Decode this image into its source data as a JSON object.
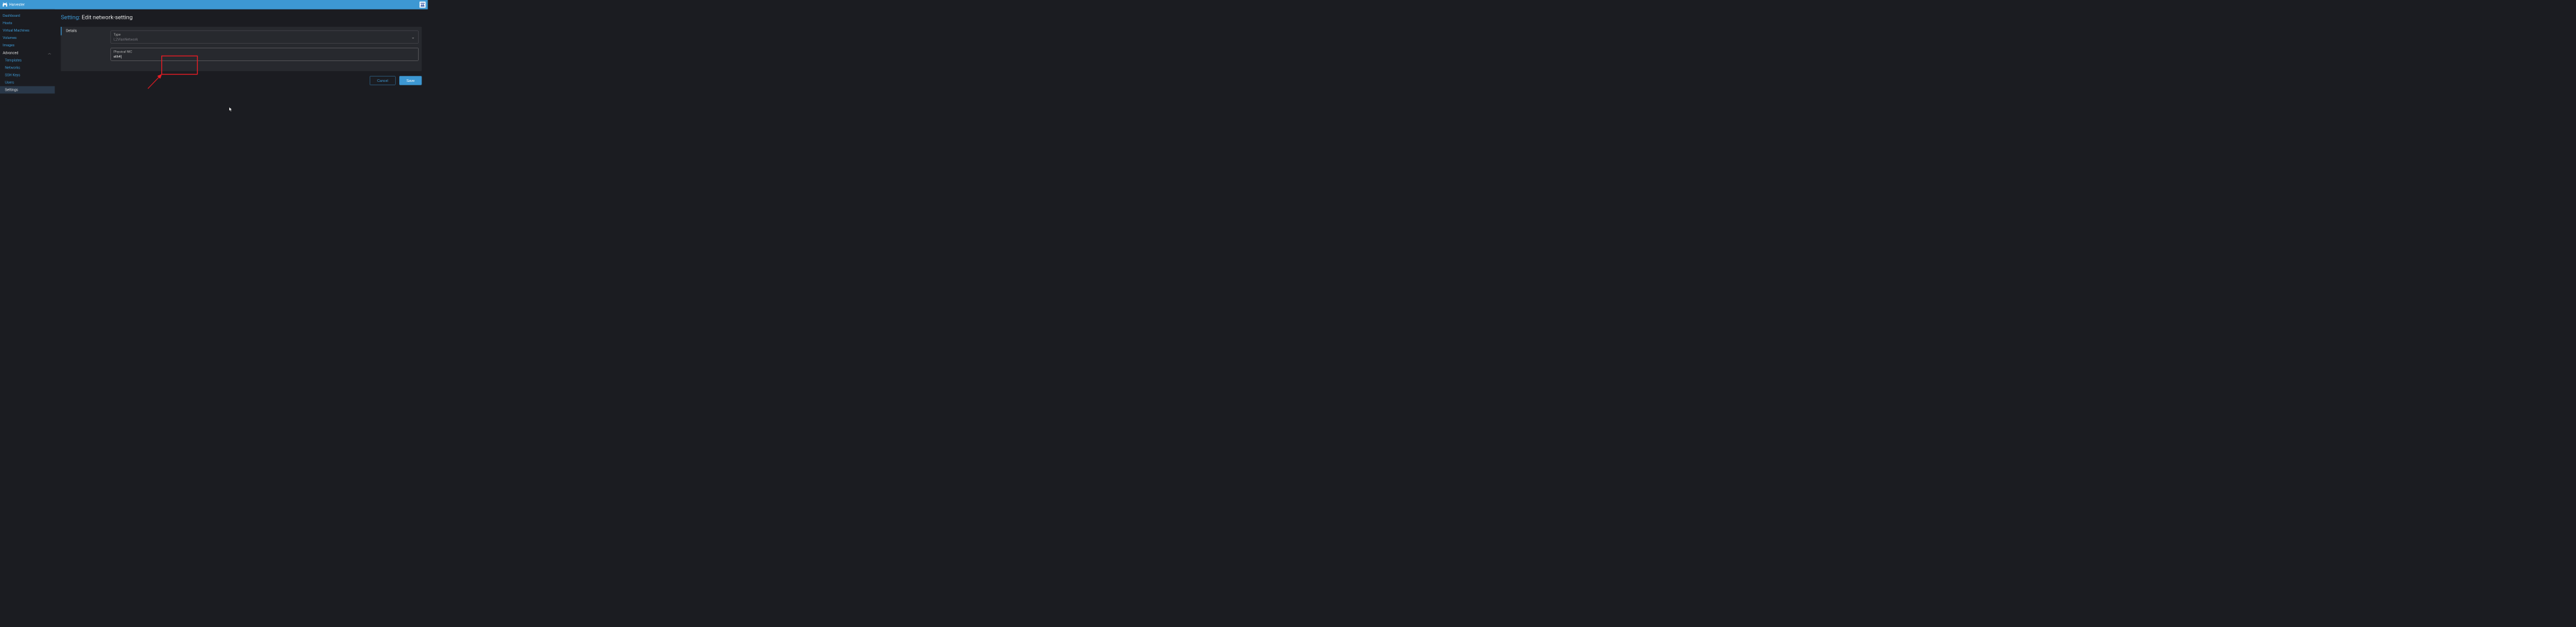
{
  "header": {
    "app_title": "Harvester"
  },
  "sidebar": {
    "items": [
      {
        "label": "Dashboard",
        "active": false,
        "sub": false
      },
      {
        "label": "Hosts",
        "active": false,
        "sub": false
      },
      {
        "label": "Virtual Machines",
        "active": false,
        "sub": false
      },
      {
        "label": "Volumes",
        "active": false,
        "sub": false
      },
      {
        "label": "Images",
        "active": false,
        "sub": false
      },
      {
        "label": "Advanced",
        "active": false,
        "sub": false,
        "expandable": true
      },
      {
        "label": "Templates",
        "active": false,
        "sub": true
      },
      {
        "label": "Networks",
        "active": false,
        "sub": true
      },
      {
        "label": "SSH Keys",
        "active": false,
        "sub": true
      },
      {
        "label": "Users",
        "active": false,
        "sub": true
      },
      {
        "label": "Settings",
        "active": true,
        "sub": true
      }
    ]
  },
  "heading": {
    "prefix": "Setting:",
    "title": "Edit network-setting"
  },
  "tabs": {
    "details": "Details"
  },
  "form": {
    "type_label": "Type",
    "type_value": "L2VlanNetwork",
    "nic_label": "Physical NIC",
    "nic_value": "eth4"
  },
  "buttons": {
    "cancel": "Cancel",
    "save": "Save"
  }
}
